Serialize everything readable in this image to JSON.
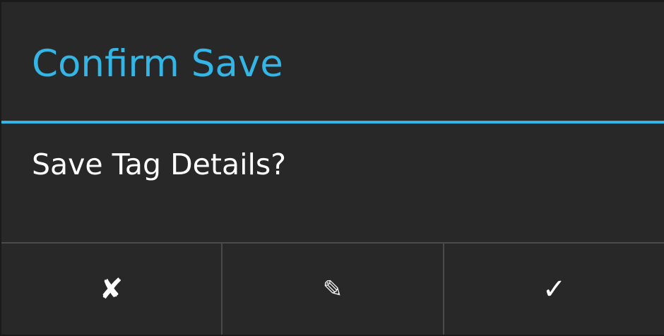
{
  "dialog": {
    "title": "Confirm Save",
    "message": "Save Tag Details?",
    "accent_color": "#33b5e5",
    "buttons": {
      "cancel": {
        "glyph": "✘",
        "icon": "cross-icon"
      },
      "edit": {
        "glyph": "✎",
        "icon": "pencil-icon"
      },
      "confirm": {
        "glyph": "✓",
        "icon": "checkmark-icon"
      }
    }
  }
}
